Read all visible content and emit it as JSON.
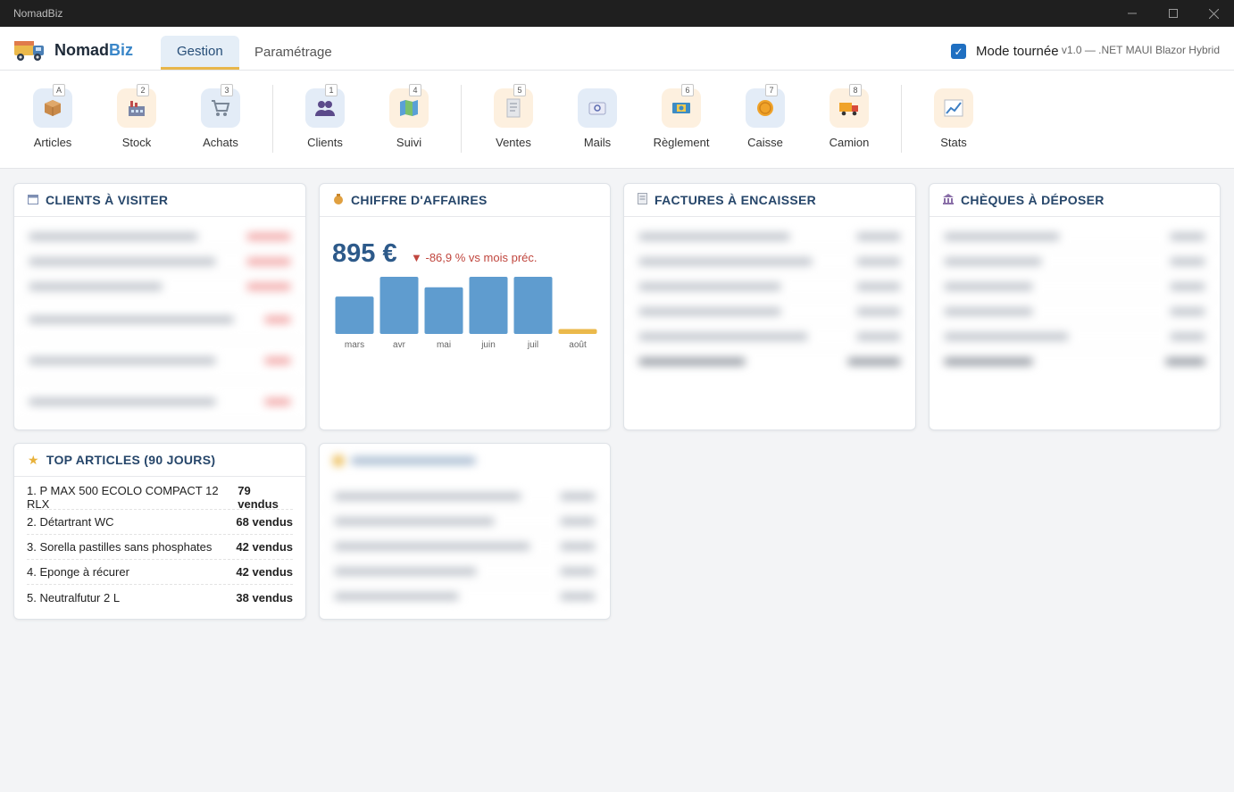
{
  "window": {
    "title": "NomadBiz"
  },
  "brand": {
    "name_part1": "Nomad",
    "name_part2": "Biz"
  },
  "tabs": [
    {
      "label": "Gestion",
      "active": true
    },
    {
      "label": "Paramétrage",
      "active": false
    }
  ],
  "mode": {
    "label": "Mode tournée",
    "checked": true
  },
  "version": "v1.0 — .NET MAUI Blazor Hybrid",
  "toolbar": [
    {
      "label": "Articles",
      "key": "A",
      "icon": "box-icon"
    },
    {
      "label": "Stock",
      "key": "2",
      "icon": "factory-icon"
    },
    {
      "label": "Achats",
      "key": "3",
      "icon": "cart-icon"
    },
    {
      "label": "Clients",
      "key": "1",
      "icon": "people-icon"
    },
    {
      "label": "Suivi",
      "key": "4",
      "icon": "map-icon"
    },
    {
      "label": "Ventes",
      "key": "5",
      "icon": "receipt-icon"
    },
    {
      "label": "Mails",
      "key": "",
      "icon": "mail-icon"
    },
    {
      "label": "Règlement",
      "key": "6",
      "icon": "banknote-icon"
    },
    {
      "label": "Caisse",
      "key": "7",
      "icon": "coin-icon"
    },
    {
      "label": "Camion",
      "key": "8",
      "icon": "truck-icon"
    },
    {
      "label": "Stats",
      "key": "",
      "icon": "chart-icon"
    }
  ],
  "cards": {
    "clients": {
      "title": "CLIENTS À VISITER",
      "icon": "calendar-icon"
    },
    "revenue": {
      "title": "CHIFFRE D'AFFAIRES",
      "icon": "moneybag-icon",
      "amount": "895 €",
      "delta": "-86,9 % vs mois préc."
    },
    "invoices": {
      "title": "FACTURES À ENCAISSER",
      "icon": "receipt-icon"
    },
    "cheques": {
      "title": "CHÈQUES À DÉPOSER",
      "icon": "bank-icon"
    },
    "top": {
      "title": "TOP ARTICLES (90 JOURS)",
      "icon": "star-icon",
      "items": [
        {
          "name": "1. P MAX 500 ECOLO COMPACT 12 RLX",
          "value": "79 vendus"
        },
        {
          "name": "2. Détartrant WC",
          "value": "68 vendus"
        },
        {
          "name": "3. Sorella pastilles sans phosphates",
          "value": "42 vendus"
        },
        {
          "name": "4. Eponge à récurer",
          "value": "42 vendus"
        },
        {
          "name": "5. Neutralfutur 2 L",
          "value": "38 vendus"
        }
      ]
    }
  },
  "chart_data": {
    "type": "bar",
    "categories": [
      "mars",
      "avr",
      "mai",
      "juin",
      "juil",
      "août"
    ],
    "values": [
      6800,
      10400,
      8500,
      10400,
      10400,
      895
    ],
    "colors": {
      "past": "#5f9ccf",
      "current": "#ebb94b"
    }
  }
}
